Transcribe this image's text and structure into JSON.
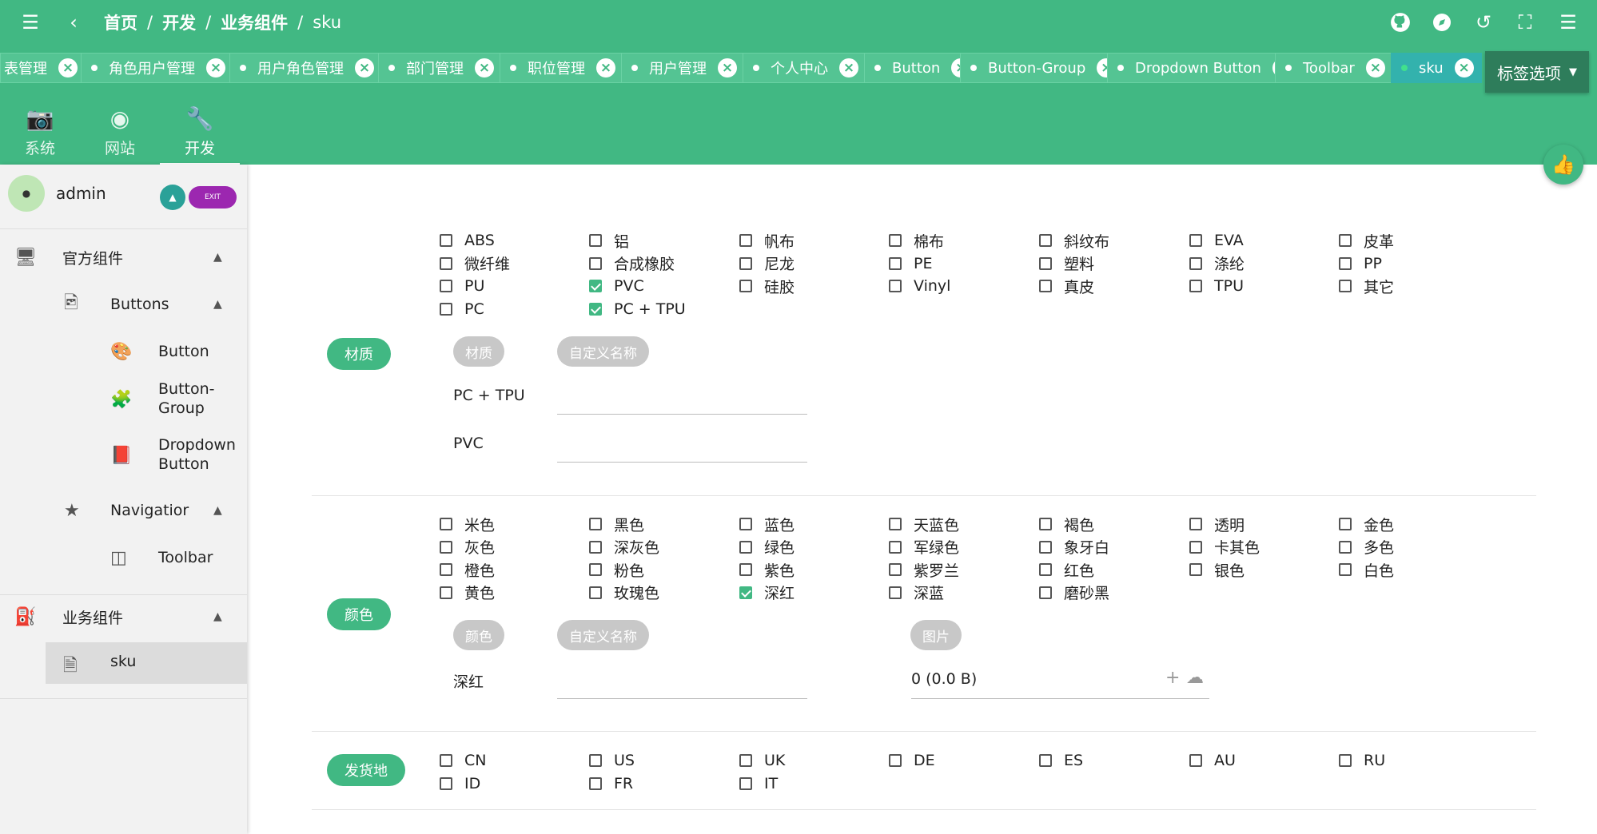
{
  "header": {
    "breadcrumb": [
      "首页",
      "开发",
      "业务组件",
      "sku"
    ],
    "icons": [
      "menu-icon",
      "back-icon",
      "github-icon",
      "compass-icon",
      "history-icon",
      "fullscreen-icon",
      "menu-right-icon"
    ]
  },
  "tabs": [
    {
      "label": "表管理",
      "active": false
    },
    {
      "label": "角色用户管理",
      "active": false
    },
    {
      "label": "用户角色管理",
      "active": false
    },
    {
      "label": "部门管理",
      "active": false
    },
    {
      "label": "职位管理",
      "active": false
    },
    {
      "label": "用户管理",
      "active": false
    },
    {
      "label": "个人中心",
      "active": false
    },
    {
      "label": "Button",
      "active": false
    },
    {
      "label": "Button-Group",
      "active": false
    },
    {
      "label": "Dropdown Button",
      "active": false
    },
    {
      "label": "Toolbar",
      "active": false
    },
    {
      "label": "sku",
      "active": true
    }
  ],
  "tag_options": "标签选项",
  "nav_tabs": [
    {
      "label": "系统",
      "icon": "camera-plus-icon"
    },
    {
      "label": "网站",
      "icon": "fingerprint-icon"
    },
    {
      "label": "开发",
      "icon": "wrench-icon",
      "active": true
    }
  ],
  "user": {
    "name": "admin",
    "exit_label": "EXIT"
  },
  "sidebar": {
    "official": "官方组件",
    "buttons": "Buttons",
    "button": "Button",
    "button_group_1": "Button-",
    "button_group_2": "Group",
    "dropdown_1": "Dropdown",
    "dropdown_2": "Button",
    "navigator": "Navigatior",
    "toolbar": "Toolbar",
    "business": "业务组件",
    "sku": "sku"
  },
  "material": {
    "label": "材质",
    "options": [
      [
        "ABS",
        "铝",
        "帆布",
        "棉布",
        "斜纹布",
        "EVA",
        "皮革"
      ],
      [
        "微纤维",
        "合成橡胶",
        "尼龙",
        "PE",
        "塑料",
        "涤纶",
        "PP"
      ],
      [
        "PU",
        "PVC",
        "硅胶",
        "Vinyl",
        "真皮",
        "TPU",
        "其它"
      ],
      [
        "PC",
        "PC + TPU"
      ]
    ],
    "checked": [
      "PVC",
      "PC + TPU"
    ],
    "col_material": "材质",
    "col_custom": "自定义名称",
    "rows": [
      "PC + TPU",
      "PVC"
    ]
  },
  "color": {
    "label": "颜色",
    "options": [
      [
        "米色",
        "黑色",
        "蓝色",
        "天蓝色",
        "褐色",
        "透明",
        "金色"
      ],
      [
        "灰色",
        "深灰色",
        "绿色",
        "军绿色",
        "象牙白",
        "卡其色",
        "多色"
      ],
      [
        "橙色",
        "粉色",
        "紫色",
        "紫罗兰",
        "红色",
        "银色",
        "白色"
      ],
      [
        "黄色",
        "玫瑰色",
        "深红",
        "深蓝",
        "磨砂黑"
      ]
    ],
    "checked": [
      "深红"
    ],
    "col_color": "颜色",
    "col_custom": "自定义名称",
    "col_image": "图片",
    "rows": [
      "深红"
    ],
    "file_size": "0 (0.0 B)"
  },
  "shipping": {
    "label": "发货地",
    "options": [
      [
        "CN",
        "US",
        "UK",
        "DE",
        "ES",
        "AU",
        "RU"
      ],
      [
        "ID",
        "FR",
        "IT"
      ]
    ],
    "checked": []
  },
  "colors": {
    "primary": "#41b883",
    "active_tab": "#33b2ad",
    "tag_options": "#2e7d5b",
    "exit": "#9c27b0"
  }
}
